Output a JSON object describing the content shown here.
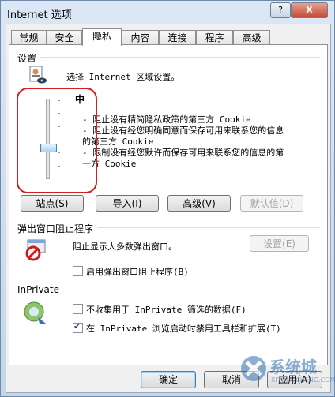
{
  "window": {
    "title": "Internet 选项",
    "help_label": "?",
    "close_label": "X"
  },
  "tabs": [
    {
      "label": "常规"
    },
    {
      "label": "安全"
    },
    {
      "label": "隐私"
    },
    {
      "label": "内容"
    },
    {
      "label": "连接"
    },
    {
      "label": "程序"
    },
    {
      "label": "高级"
    }
  ],
  "settings": {
    "group_label": "设置",
    "zone_text": "选择 Internet 区域设置。",
    "level_label": "中",
    "slider_level": "中",
    "descriptions": [
      "- 阻止没有精简隐私政策的第三方 Cookie",
      "- 阻止没有经您明确同意而保存可用来联系您的信息",
      "的第三方 Cookie",
      "- 限制没有经您默许而保存可用来联系您的信息的第",
      "一方 Cookie"
    ],
    "buttons": {
      "sites": "站点(S)",
      "import": "导入(I)",
      "advanced": "高级(V)",
      "default": "默认值(D)"
    }
  },
  "popup": {
    "group_label": "弹出窗口阻止程序",
    "text": "阻止显示大多数弹出窗口。",
    "settings_button": "设置(E)",
    "enable_label": "启用弹出窗口阻止程序(B)",
    "enable_checked": false
  },
  "inprivate": {
    "group_label": "InPrivate",
    "option1_label": "不收集用于 InPrivate 筛选的数据(F)",
    "option1_checked": false,
    "option2_label": "在 InPrivate 浏览启动时禁用工具栏和扩展(T)",
    "option2_checked": true
  },
  "footer": {
    "ok": "确定",
    "cancel": "取消",
    "apply": "应用(A)"
  },
  "watermark": {
    "text": "系统城",
    "url": "XITONGCHENG.COM"
  }
}
